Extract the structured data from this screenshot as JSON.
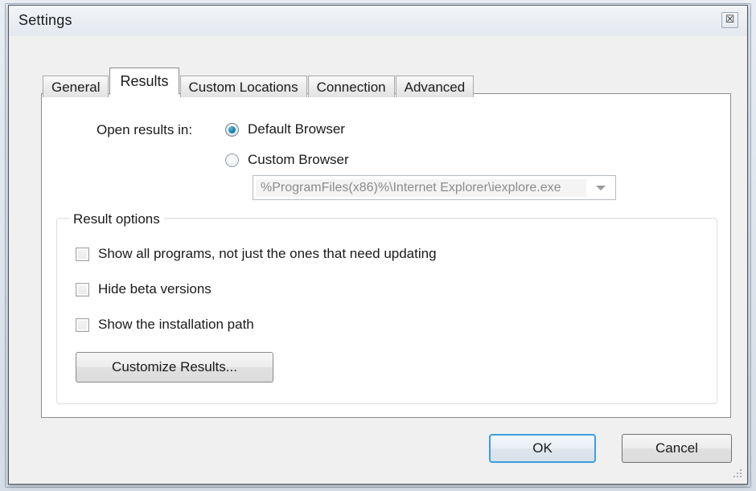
{
  "window": {
    "title": "Settings",
    "close_icon": "close-icon",
    "close_glyph": "☒"
  },
  "tabs": [
    {
      "label": "General",
      "active": false
    },
    {
      "label": "Results",
      "active": true
    },
    {
      "label": "Custom Locations",
      "active": false
    },
    {
      "label": "Connection",
      "active": false
    },
    {
      "label": "Advanced",
      "active": false
    }
  ],
  "results_tab": {
    "open_results_label": "Open results in:",
    "radios": [
      {
        "label": "Default Browser",
        "checked": true
      },
      {
        "label": "Custom Browser",
        "checked": false
      }
    ],
    "custom_browser_combo": {
      "value": "%ProgramFiles(x86)%\\Internet Explorer\\iexplore.exe",
      "arrow_icon": "chevron-down-icon",
      "enabled": false
    },
    "group": {
      "legend": "Result options",
      "checkboxes": [
        {
          "label": "Show all programs, not just the ones that need updating",
          "checked": false
        },
        {
          "label": "Hide beta versions",
          "checked": false
        },
        {
          "label": "Show the installation path",
          "checked": false
        }
      ],
      "customize_button": "Customize Results..."
    }
  },
  "footer": {
    "ok_label": "OK",
    "cancel_label": "Cancel"
  },
  "colors": {
    "accent_focus": "#3c9ede",
    "radio_dot": "#1b7fb0",
    "dialog_bg": "#f0f0f0",
    "panel_bg": "#ffffff",
    "frame_border": "#4a5562"
  }
}
